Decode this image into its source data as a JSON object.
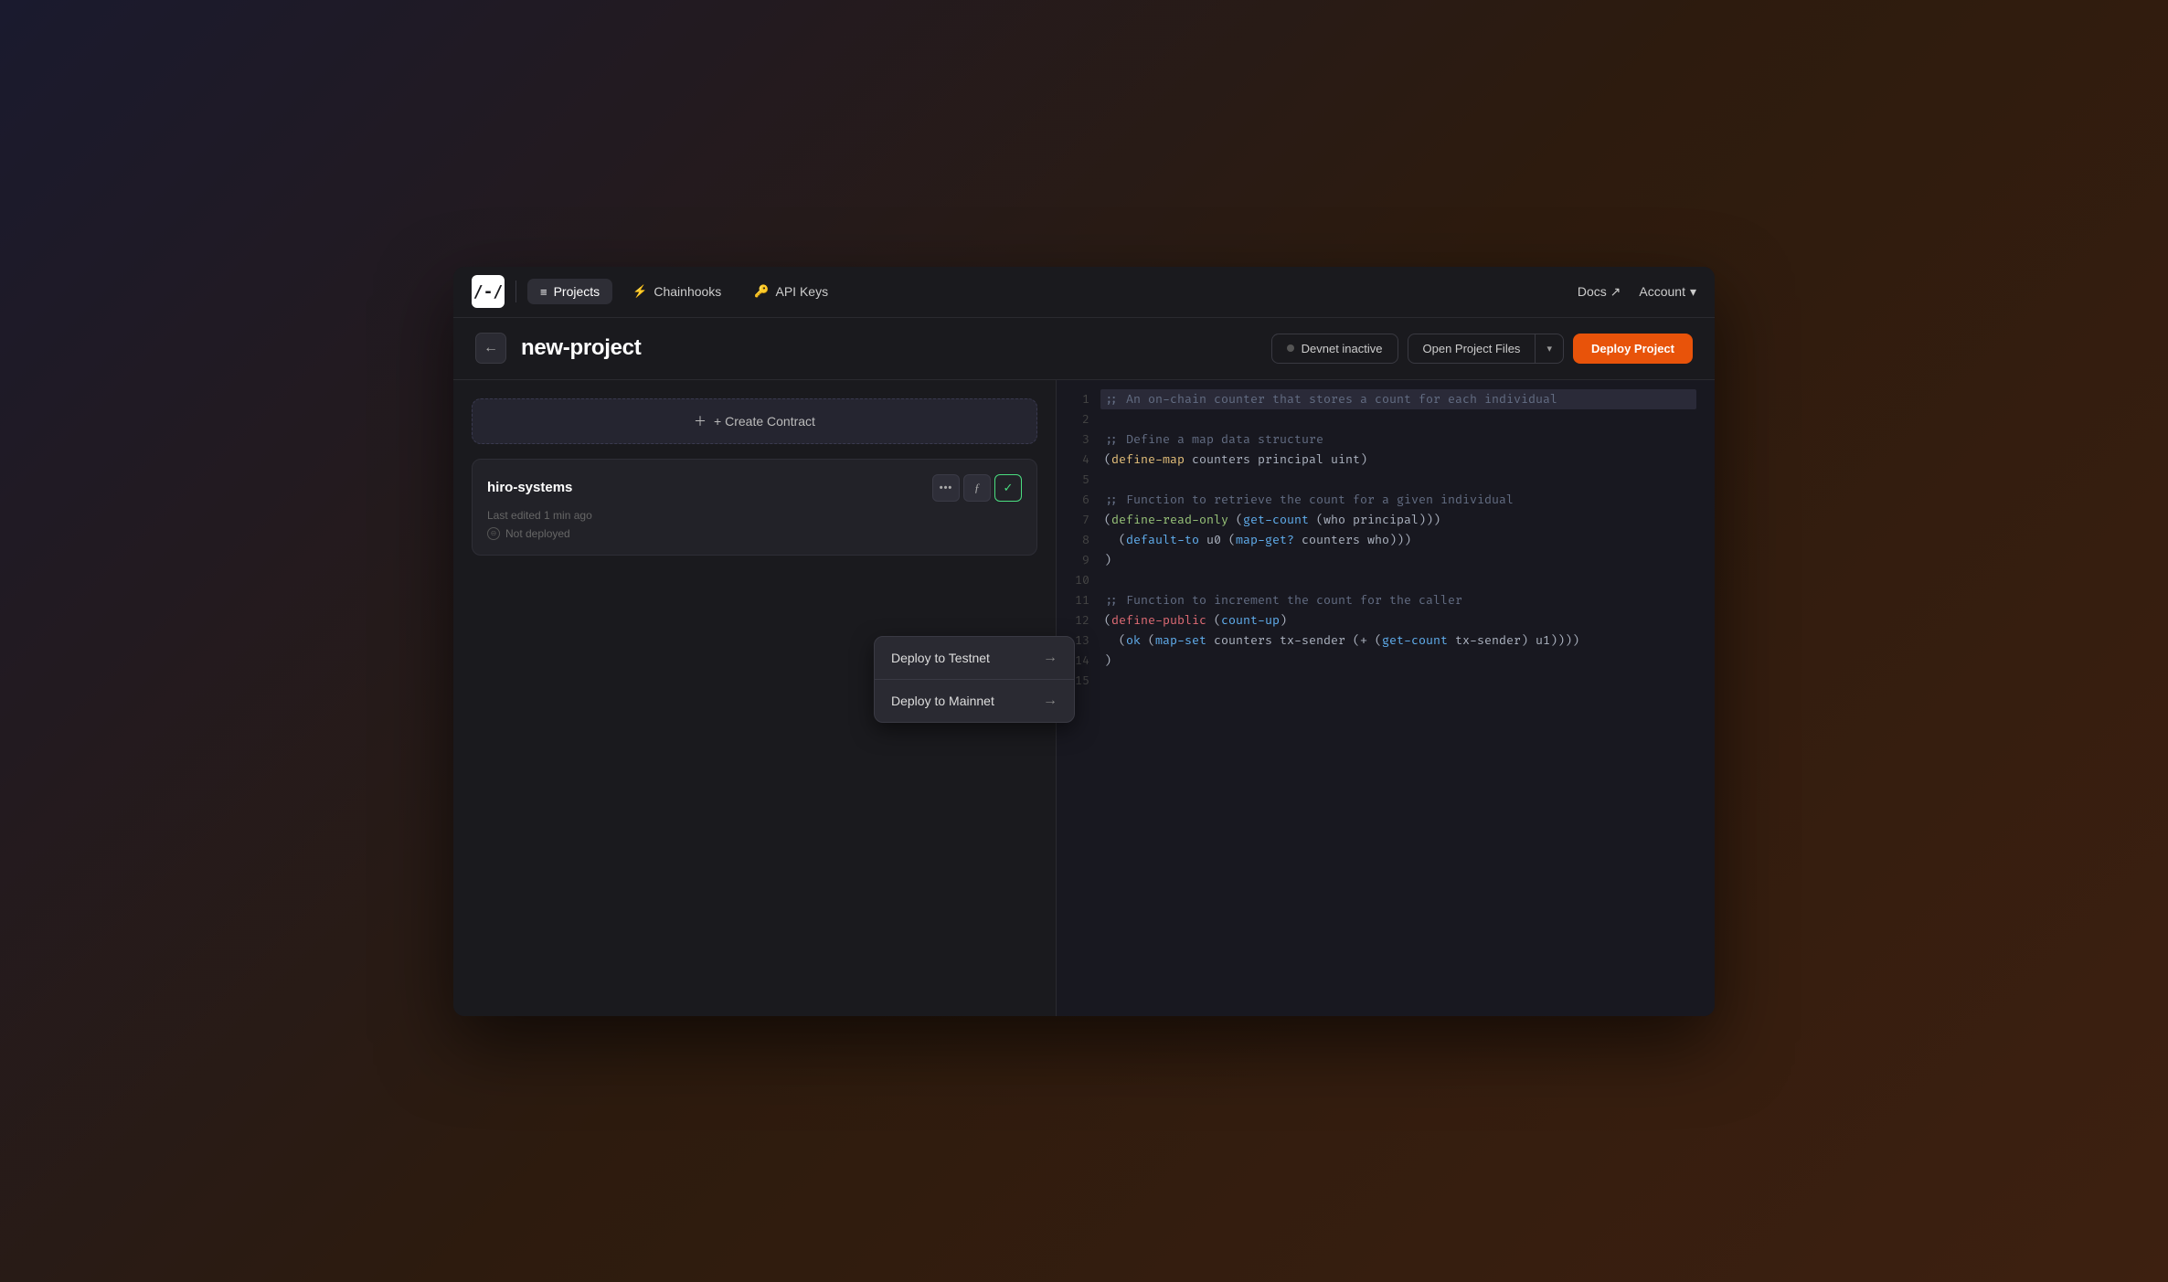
{
  "app": {
    "logo_text": "/-/",
    "nav_items": [
      {
        "id": "projects",
        "label": "Projects",
        "icon": "≡",
        "active": true
      },
      {
        "id": "chainhooks",
        "label": "Chainhooks",
        "icon": "⚡",
        "active": false
      },
      {
        "id": "api-keys",
        "label": "API Keys",
        "icon": "🔑",
        "active": false
      }
    ],
    "nav_right": {
      "docs_label": "Docs ↗",
      "account_label": "Account",
      "account_caret": "▾"
    }
  },
  "page": {
    "back_icon": "←",
    "title": "new-project",
    "devnet_status": "Devnet inactive",
    "open_files_label": "Open Project Files",
    "deploy_label": "Deploy Project"
  },
  "sidebar": {
    "create_label": "+ Create Contract",
    "contract": {
      "name": "hiro-systems",
      "last_edited": "Last edited 1 min ago",
      "status": "Not deployed"
    },
    "dropdown": {
      "items": [
        {
          "id": "testnet",
          "label": "Deploy to Testnet"
        },
        {
          "id": "mainnet",
          "label": "Deploy to Mainnet"
        }
      ]
    }
  },
  "code": {
    "lines": [
      {
        "num": 1,
        "text": ";; An on-chain counter that stores a count for each individual",
        "highlight": true
      },
      {
        "num": 2,
        "text": ""
      },
      {
        "num": 3,
        "text": ";; Define a map data structure"
      },
      {
        "num": 4,
        "text": "(define-map counters principal uint)"
      },
      {
        "num": 5,
        "text": ""
      },
      {
        "num": 6,
        "text": ";; Function to retrieve the count for a given individual"
      },
      {
        "num": 7,
        "text": "(define-read-only (get-count (who principal))"
      },
      {
        "num": 8,
        "text": "  (default-to u0 (map-get? counters who))"
      },
      {
        "num": 9,
        "text": ")"
      },
      {
        "num": 10,
        "text": ""
      },
      {
        "num": 11,
        "text": ";; Function to increment the count for the caller"
      },
      {
        "num": 12,
        "text": "(define-public (count-up)"
      },
      {
        "num": 13,
        "text": "  (ok (map-set counters tx-sender (+ (get-count tx-sender) u1)))"
      },
      {
        "num": 14,
        "text": ")"
      },
      {
        "num": 15,
        "text": ""
      }
    ]
  }
}
